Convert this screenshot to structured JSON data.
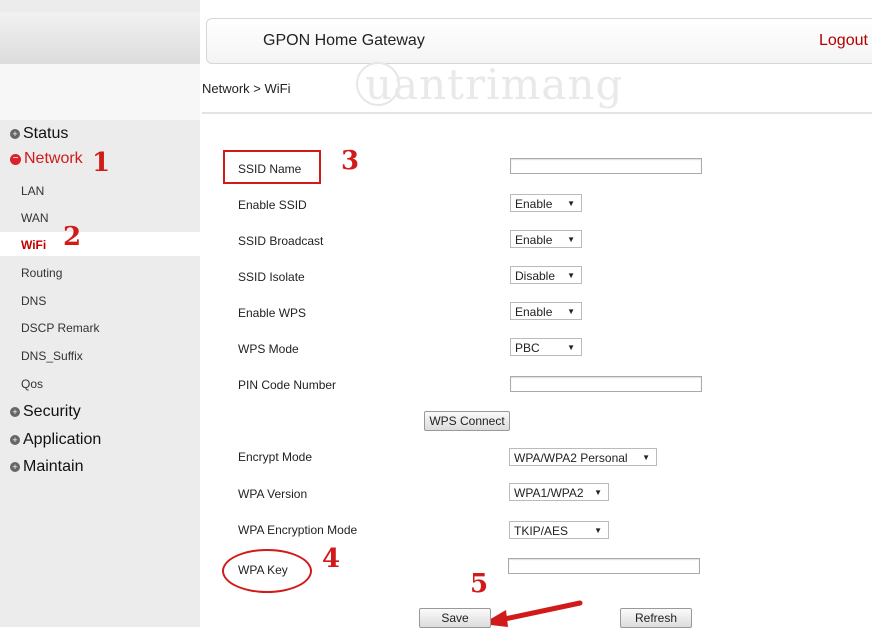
{
  "header": {
    "title": "GPON Home Gateway",
    "logout": "Logout"
  },
  "breadcrumb": "Network > WiFi",
  "watermark": "uantrimang",
  "sidebar": {
    "groups": [
      {
        "label": "Status",
        "icon": "plus-circle-icon"
      },
      {
        "label": "Network",
        "icon": "minus-circle-icon"
      },
      {
        "label": "Security",
        "icon": "plus-circle-icon"
      },
      {
        "label": "Application",
        "icon": "plus-circle-icon"
      },
      {
        "label": "Maintain",
        "icon": "plus-circle-icon"
      }
    ],
    "network_items": [
      "LAN",
      "WAN",
      "WiFi",
      "Routing",
      "DNS",
      "DSCP Remark",
      "DNS_Suffix",
      "Qos"
    ],
    "active_item": "WiFi"
  },
  "form": {
    "ssid_name": {
      "label": "SSID Name",
      "value": ""
    },
    "enable_ssid": {
      "label": "Enable SSID",
      "value": "Enable"
    },
    "ssid_broadcast": {
      "label": "SSID Broadcast",
      "value": "Enable"
    },
    "ssid_isolate": {
      "label": "SSID Isolate",
      "value": "Disable"
    },
    "enable_wps": {
      "label": "Enable WPS",
      "value": "Enable"
    },
    "wps_mode": {
      "label": "WPS Mode",
      "value": "PBC"
    },
    "pin_code": {
      "label": "PIN Code Number",
      "value": ""
    },
    "wps_connect": "WPS Connect",
    "encrypt_mode": {
      "label": "Encrypt Mode",
      "value": "WPA/WPA2 Personal"
    },
    "wpa_version": {
      "label": "WPA Version",
      "value": "WPA1/WPA2"
    },
    "wpa_encryption": {
      "label": "WPA Encryption Mode",
      "value": "TKIP/AES"
    },
    "wpa_key": {
      "label": "WPA Key",
      "value": ""
    },
    "save": "Save",
    "refresh": "Refresh"
  },
  "annotations": {
    "step1": "1",
    "step2": "2",
    "step3": "3",
    "step4": "4",
    "step5": "5"
  },
  "colors": {
    "annotation": "#d11a1a",
    "active_nav": "#c00000",
    "logout": "#b30000"
  }
}
